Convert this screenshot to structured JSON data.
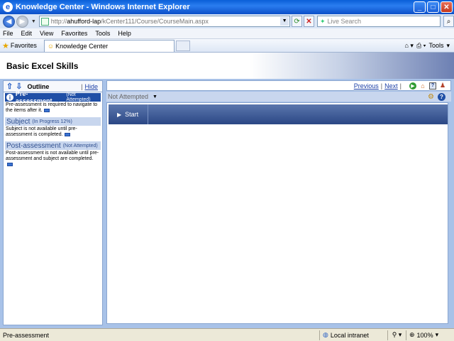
{
  "window": {
    "title": "Knowledge Center - Windows Internet Explorer"
  },
  "address": {
    "url_prefix": "http://",
    "url_host": "ahufford-lap",
    "url_path": "/kCenter111/Course/CourseMain.aspx",
    "search_placeholder": "Live Search"
  },
  "menu": [
    "File",
    "Edit",
    "View",
    "Favorites",
    "Tools",
    "Help"
  ],
  "favorites": {
    "label": "Favorites",
    "tab_label": "Knowledge Center",
    "tools_label": "Tools"
  },
  "course": {
    "title": "Basic Excel Skills"
  },
  "outline": {
    "label": "Outline",
    "hide_label": "Hide",
    "sections": [
      {
        "title": "Pre-assessment",
        "status": "(Not Attempted)",
        "desc": "Pre-assessment is required to navigate to the items after it."
      },
      {
        "title": "Subject",
        "status": "(In Progress 12%)",
        "desc": "Subject is not available until pre-assessment is completed."
      },
      {
        "title": "Post-assessment",
        "status": "(Not Attempted)",
        "desc": "Post-assessment is not available until pre-assessment and subject are completed."
      }
    ]
  },
  "content": {
    "previous_label": "Previous",
    "next_label": "Next",
    "status_value": "Not Attempted",
    "start_label": "Start"
  },
  "statusbar": {
    "text": "Pre-assessment",
    "zone": "Local intranet",
    "zoom": "100%"
  }
}
